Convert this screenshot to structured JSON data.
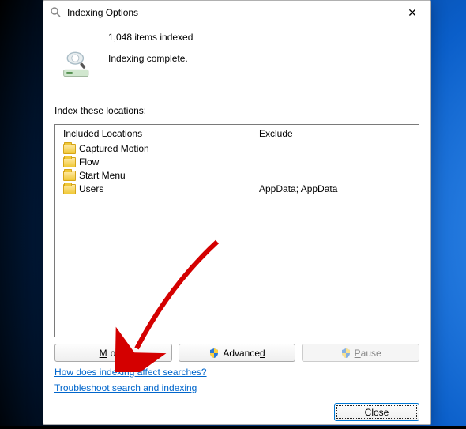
{
  "titlebar": {
    "title": "Indexing Options",
    "close_char": "✕"
  },
  "status": {
    "count_line": "1,048 items indexed",
    "status_line": "Indexing complete."
  },
  "locations_label": "Index these locations:",
  "columns": {
    "included": "Included Locations",
    "exclude": "Exclude"
  },
  "locations": [
    {
      "name": "Captured Motion",
      "exclude": ""
    },
    {
      "name": "Flow",
      "exclude": ""
    },
    {
      "name": "Start Menu",
      "exclude": ""
    },
    {
      "name": "Users",
      "exclude": "AppData; AppData"
    }
  ],
  "buttons": {
    "modify_pre": "",
    "modify_u": "M",
    "modify_post": "odify",
    "advanced_pre": "Advance",
    "advanced_u": "d",
    "advanced_post": "",
    "pause_pre": "",
    "pause_u": "P",
    "pause_post": "ause",
    "close": "Close"
  },
  "links": {
    "help": "How does indexing affect searches?",
    "troubleshoot": "Troubleshoot search and indexing"
  }
}
